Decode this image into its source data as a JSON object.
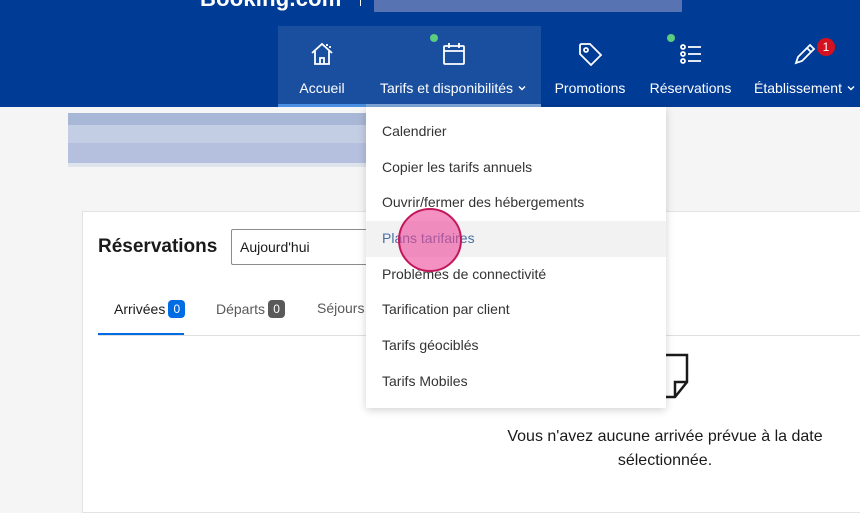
{
  "header": {
    "brand": "Booking.com",
    "nav": [
      {
        "label": "Accueil",
        "icon": "home-icon",
        "state": "active"
      },
      {
        "label": "Tarifs et disponibilités",
        "icon": "calendar-icon",
        "state": "open",
        "has_dot": true,
        "chevron": true
      },
      {
        "label": "Promotions",
        "icon": "tag-icon"
      },
      {
        "label": "Réservations",
        "icon": "list-icon",
        "has_dot": true
      },
      {
        "label": "Établissement",
        "icon": "pen-icon",
        "badge": "1",
        "chevron": true
      }
    ]
  },
  "dropdown": {
    "items": [
      "Calendrier",
      "Copier les tarifs annuels",
      "Ouvrir/fermer des hébergements",
      "Plans tarifaires",
      "Problèmes de connectivité",
      "Tarification par client",
      "Tarifs géociblés",
      "Tarifs Mobiles"
    ],
    "hovered_index": 3
  },
  "reservations": {
    "title": "Réservations",
    "date_select": "Aujourd'hui",
    "tabs": [
      {
        "label": "Arrivées",
        "count": "0"
      },
      {
        "label": "Départs",
        "count": "0"
      },
      {
        "label": "Séjours",
        "count": ""
      }
    ],
    "empty_message": "Vous n'avez aucune arrivée prévue à la date sélectionnée."
  },
  "colors": {
    "header_bg": "#003b95",
    "accent": "#006ce4",
    "badge": "#d4111e",
    "dot": "#5ccc7e"
  }
}
